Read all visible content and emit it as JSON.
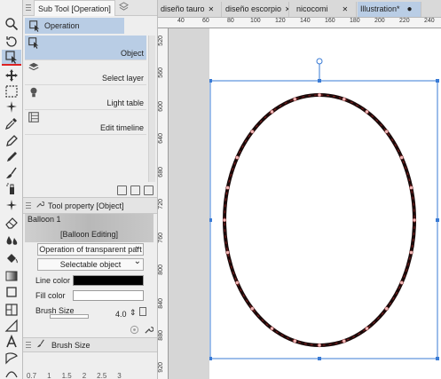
{
  "subtool_panel": {
    "title": "Sub Tool [Operation]",
    "group_label": "Operation",
    "items": [
      {
        "label": "Object",
        "selected": true
      },
      {
        "label": "Select layer",
        "selected": false
      },
      {
        "label": "Light table",
        "selected": false
      },
      {
        "label": "Edit timeline",
        "selected": false
      }
    ]
  },
  "tool_property": {
    "title": "Tool property [Object]",
    "balloon_name": "Balloon 1",
    "balloon_sub": "[Balloon Editing]",
    "operation_dropdown": "Operation of transparent part",
    "selectable_dropdown": "Selectable object",
    "line_color_label": "Line color",
    "fill_color_label": "Fill color",
    "brush_size_label": "Brush Size",
    "brush_size_value": "4.0",
    "line_color": "#000000",
    "fill_color": "#ffffff"
  },
  "brush_size_panel": {
    "title": "Brush Size",
    "scale": [
      "0.7",
      "1",
      "1.5",
      "2",
      "2.5",
      "3"
    ]
  },
  "document_tabs": [
    {
      "label": "diseño tauro",
      "active": false
    },
    {
      "label": "diseño escorpio",
      "active": false
    },
    {
      "label": "nicocomi",
      "active": false
    },
    {
      "label": "Illustration*",
      "active": true
    }
  ],
  "rulers": {
    "horizontal": [
      "40",
      "60",
      "80",
      "100",
      "120",
      "140",
      "160",
      "180",
      "200",
      "220",
      "240"
    ],
    "vertical": [
      "520",
      "560",
      "600",
      "640",
      "680",
      "720",
      "760",
      "800",
      "840",
      "880",
      "920"
    ]
  },
  "colors": {
    "accent": "#b9cde5",
    "selection_box": "#3a7bd5",
    "ellipse_stroke": "#2b1010",
    "control_point": "#f2b8b8"
  }
}
